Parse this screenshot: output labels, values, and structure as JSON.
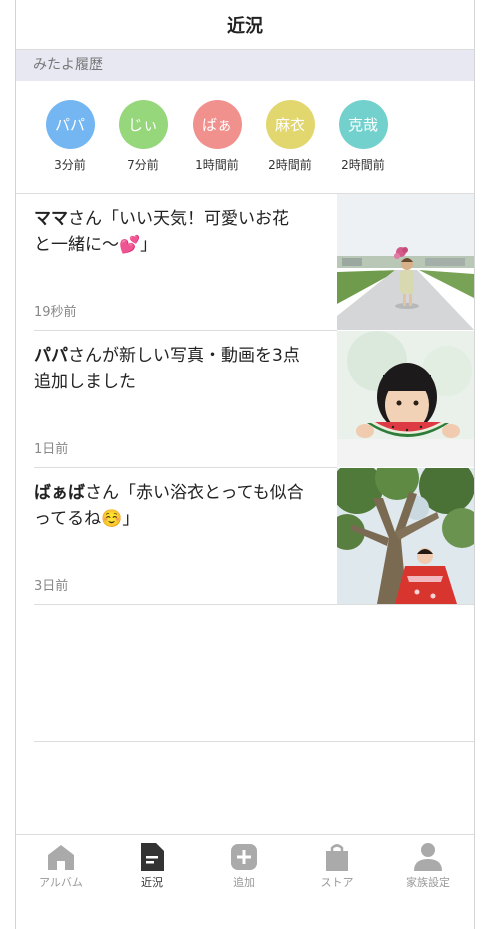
{
  "header": {
    "title": "近況"
  },
  "history": {
    "label": "みたよ履歴",
    "items": [
      {
        "name": "パパ",
        "time": "3分前",
        "color": "#74b6f2"
      },
      {
        "name": "じぃ",
        "time": "7分前",
        "color": "#95d77a"
      },
      {
        "name": "ばぁ",
        "time": "1時間前",
        "color": "#f1918e"
      },
      {
        "name": "麻衣",
        "time": "2時間前",
        "color": "#e2d66e"
      },
      {
        "name": "克哉",
        "time": "2時間前",
        "color": "#73d1cd"
      }
    ]
  },
  "feed": [
    {
      "author": "ママ",
      "text": "さん「いい天気！可愛いお花と一緒に～💕」",
      "time": "19秒前",
      "photo": "girl-with-flowers-on-road"
    },
    {
      "author": "パパ",
      "text": "さんが新しい写真・動画を3点追加しました",
      "time": "1日前",
      "photo": "child-eating-watermelon"
    },
    {
      "author": "ばぁば",
      "text": "さん「赤い浴衣とっても似合ってるね☺️」",
      "time": "3日前",
      "photo": "child-in-red-yukata-under-tree"
    }
  ],
  "tabs": [
    {
      "label": "アルバム",
      "icon": "home-icon"
    },
    {
      "label": "近況",
      "icon": "document-icon"
    },
    {
      "label": "追加",
      "icon": "plus-icon"
    },
    {
      "label": "ストア",
      "icon": "shopping-bag-icon"
    },
    {
      "label": "家族設定",
      "icon": "person-icon"
    }
  ],
  "colors": {
    "active_tab": "#333333",
    "inactive_tab": "#aaaaaa",
    "history_bg": "#e8e8f3"
  }
}
